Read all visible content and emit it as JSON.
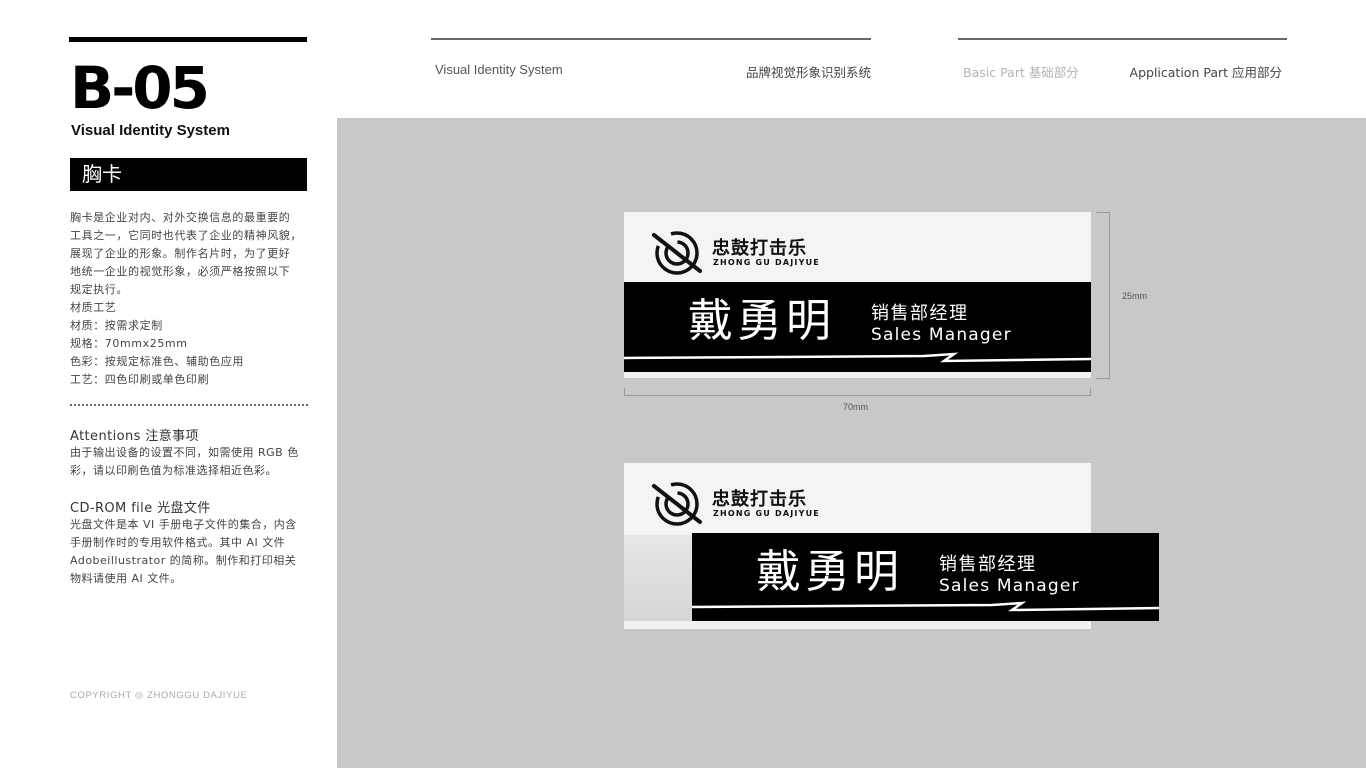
{
  "page": {
    "code": "B-05",
    "subtitle": "Visual Identity System",
    "section_title": "胸卡",
    "description": [
      "胸卡是企业对内、对外交换信息的最重要的",
      "工具之一，它同时也代表了企业的精神风貌，",
      "展现了企业的形象。制作名片时，为了更好",
      "地统一企业的视觉形象，必须严格按照以下",
      "规定执行。",
      "材质工艺",
      "材质：按需求定制",
      "规格：70mmx25mm",
      "色彩：按规定标准色、辅助色应用",
      "工艺：四色印刷或单色印刷"
    ],
    "attentions": {
      "title": "Attentions 注意事项",
      "lines": [
        "由于输出设备的设置不同，如需使用 RGB 色",
        "彩，请以印刷色值为标准选择相近色彩。"
      ]
    },
    "cdrom": {
      "title": "CD-ROM file 光盘文件",
      "lines": [
        "光盘文件是本 VI 手册电子文件的集合，内含",
        "手册制作时的专用软件格式。其中 AI 文件",
        "Adobeillustrator 的简称。制作和打印相关",
        "物料请使用 AI 文件。"
      ]
    },
    "copyright": "COPYRIGHT ◎ ZHONGGU DAJIYUE"
  },
  "header": {
    "left": "Visual Identity System",
    "left_cn": "品牌视觉形象识别系统",
    "basic": "Basic Part 基础部分",
    "application": "Application Part 应用部分"
  },
  "badge": {
    "brand_cn": "忠鼓打击乐",
    "brand_en": "ZHONG GU DAJIYUE",
    "name": "戴勇明",
    "title_cn": "销售部经理",
    "title_en": "Sales Manager",
    "width_label": "70mm",
    "height_label": "25mm"
  },
  "colors": {
    "stage": "#c8c8ca",
    "band": "#000000",
    "text_muted": "#b3b3b3"
  }
}
